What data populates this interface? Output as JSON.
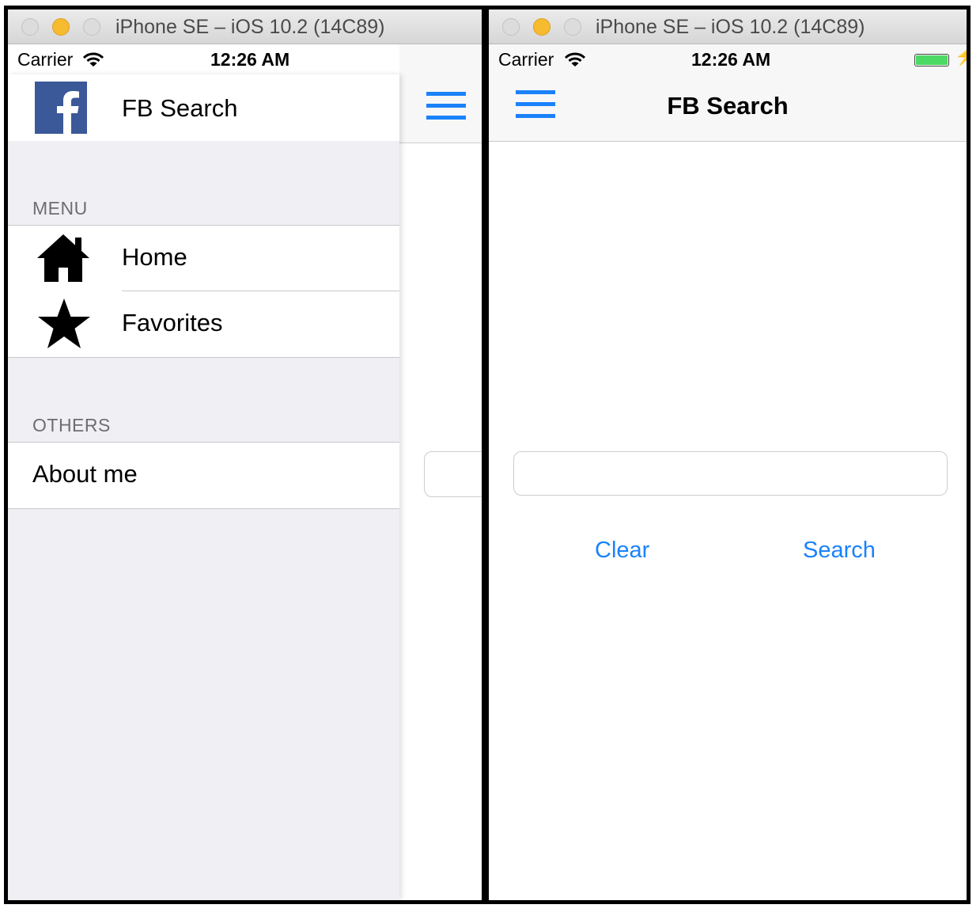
{
  "left_simulator": {
    "window_title": "iPhone SE – iOS 10.2 (14C89)",
    "status": {
      "carrier": "Carrier",
      "time": "12:26 AM"
    },
    "drawer": {
      "header_title": "FB Search",
      "logo_icon": "facebook-logo",
      "menu_section": "MENU",
      "menu_items": [
        {
          "label": "Home",
          "icon": "home-icon"
        },
        {
          "label": "Favorites",
          "icon": "star-icon"
        }
      ],
      "others_section": "OTHERS",
      "others_items": [
        {
          "label": "About me"
        }
      ]
    }
  },
  "right_simulator": {
    "window_title": "iPhone SE – iOS 10.2 (14C89)",
    "status": {
      "carrier": "Carrier",
      "time": "12:26 AM"
    },
    "nav_title": "FB Search",
    "search": {
      "value": "",
      "placeholder": ""
    },
    "buttons": {
      "clear": "Clear",
      "search": "Search"
    }
  },
  "colors": {
    "tint": "#1a82fb",
    "facebook_blue": "#3b5998",
    "battery_green": "#4cd964",
    "grouped_background": "#efeff4",
    "traffic_yellow": "#f6bb2e"
  }
}
